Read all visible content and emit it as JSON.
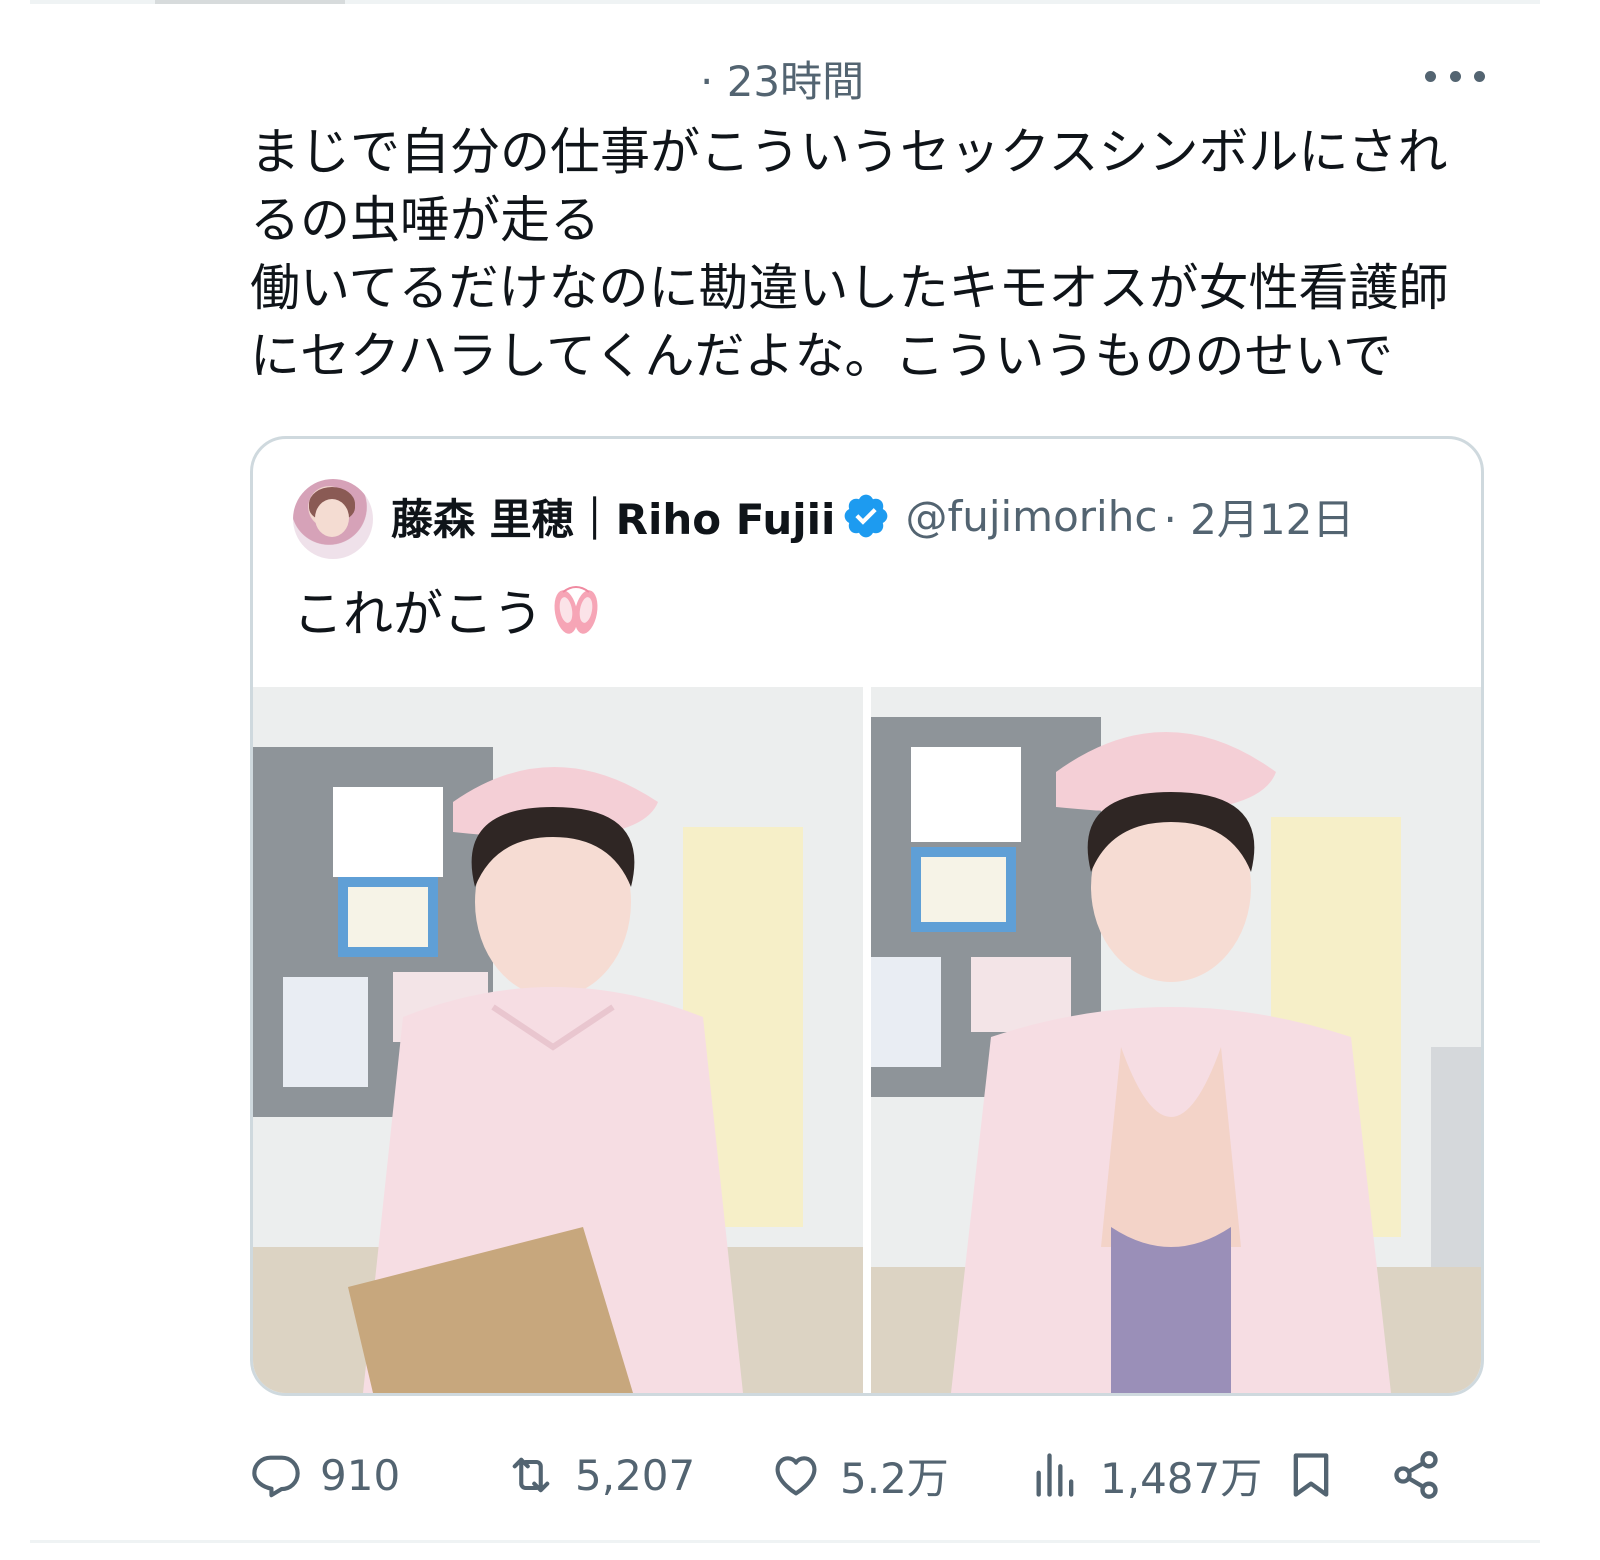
{
  "post": {
    "timestamp": "· 23時間",
    "text": "まじで自分の仕事がこういうセックスシンボルにされ\nるの虫唾が走る\n働いてるだけなのに勘違いしたキモオスが女性看護師\nにセクハラしてくんだよな。こういうもののせいで"
  },
  "quote": {
    "display_name": "藤森 里穂｜Riho Fujii",
    "handle": "@fujimorihc",
    "date": "· 2月12日",
    "text": "これがこう",
    "verified_color": "#1d9bf0",
    "emoji_icon": "ballet-shoes-icon"
  },
  "actions": {
    "replies": "910",
    "reposts": "5,207",
    "likes": "5.2万",
    "views": "1,487万"
  },
  "colors": {
    "text": "#0f1419",
    "muted": "#536471",
    "border": "#cfd9de"
  }
}
